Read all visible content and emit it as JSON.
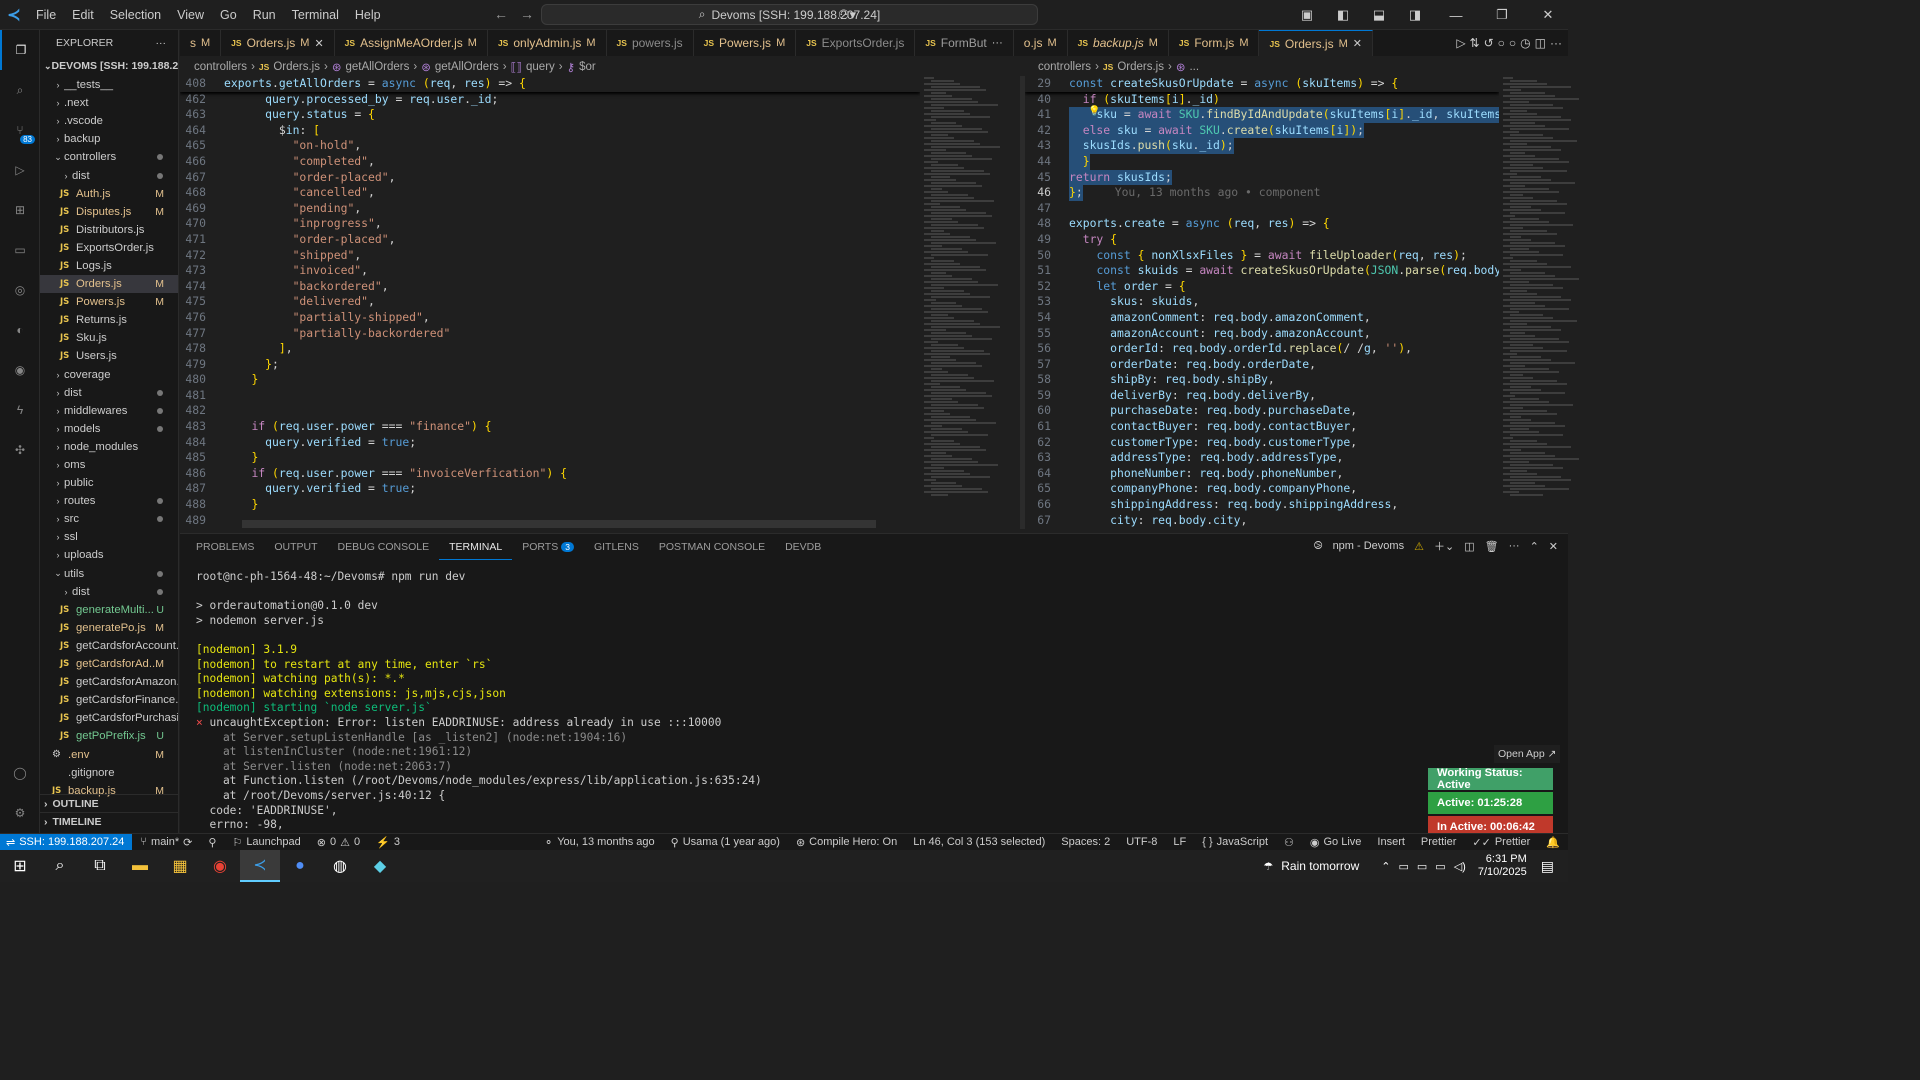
{
  "titlebar": {
    "menu": [
      "File",
      "Edit",
      "Selection",
      "View",
      "Go",
      "Run",
      "Terminal",
      "Help"
    ],
    "search": "Devoms [SSH: 199.188.207.24]"
  },
  "sidebar": {
    "title": "EXPLORER",
    "root": "DEVOMS [SSH: 199.188.20...",
    "items": [
      {
        "type": "folder",
        "label": "__tests__",
        "depth": 1,
        "open": false
      },
      {
        "type": "folder",
        "label": ".next",
        "depth": 1,
        "open": false
      },
      {
        "type": "folder",
        "label": ".vscode",
        "depth": 1,
        "open": false
      },
      {
        "type": "folder",
        "label": "backup",
        "depth": 1,
        "open": false
      },
      {
        "type": "folder",
        "label": "controllers",
        "depth": 1,
        "open": true,
        "dot": true
      },
      {
        "type": "folder",
        "label": "dist",
        "depth": 2,
        "open": false,
        "dot": true
      },
      {
        "type": "file",
        "label": "Auth.js",
        "depth": 2,
        "status": "M"
      },
      {
        "type": "file",
        "label": "Disputes.js",
        "depth": 2,
        "status": "M"
      },
      {
        "type": "file",
        "label": "Distributors.js",
        "depth": 2
      },
      {
        "type": "file",
        "label": "ExportsOrder.js",
        "depth": 2
      },
      {
        "type": "file",
        "label": "Logs.js",
        "depth": 2
      },
      {
        "type": "file",
        "label": "Orders.js",
        "depth": 2,
        "status": "M",
        "selected": true
      },
      {
        "type": "file",
        "label": "Powers.js",
        "depth": 2,
        "status": "M"
      },
      {
        "type": "file",
        "label": "Returns.js",
        "depth": 2
      },
      {
        "type": "file",
        "label": "Sku.js",
        "depth": 2
      },
      {
        "type": "file",
        "label": "Users.js",
        "depth": 2
      },
      {
        "type": "folder",
        "label": "coverage",
        "depth": 1,
        "open": false
      },
      {
        "type": "folder",
        "label": "dist",
        "depth": 1,
        "open": false,
        "dot": true
      },
      {
        "type": "folder",
        "label": "middlewares",
        "depth": 1,
        "open": false,
        "dot": true
      },
      {
        "type": "folder",
        "label": "models",
        "depth": 1,
        "open": false,
        "dot": true
      },
      {
        "type": "folder",
        "label": "node_modules",
        "depth": 1,
        "open": false
      },
      {
        "type": "folder",
        "label": "oms",
        "depth": 1,
        "open": false
      },
      {
        "type": "folder",
        "label": "public",
        "depth": 1,
        "open": false
      },
      {
        "type": "folder",
        "label": "routes",
        "depth": 1,
        "open": false,
        "dot": true
      },
      {
        "type": "folder",
        "label": "src",
        "depth": 1,
        "open": false,
        "dot": true
      },
      {
        "type": "folder",
        "label": "ssl",
        "depth": 1,
        "open": false
      },
      {
        "type": "folder",
        "label": "uploads",
        "depth": 1,
        "open": false
      },
      {
        "type": "folder",
        "label": "utils",
        "depth": 1,
        "open": true,
        "dot": true
      },
      {
        "type": "folder",
        "label": "dist",
        "depth": 2,
        "open": false,
        "dot": true
      },
      {
        "type": "file",
        "label": "generateMulti...",
        "depth": 2,
        "status": "U"
      },
      {
        "type": "file",
        "label": "generatePo.js",
        "depth": 2,
        "status": "M"
      },
      {
        "type": "file",
        "label": "getCardsforAccount.js",
        "depth": 2
      },
      {
        "type": "file",
        "label": "getCardsforAd...",
        "depth": 2,
        "status": "M"
      },
      {
        "type": "file",
        "label": "getCardsforAmazon.js",
        "depth": 2
      },
      {
        "type": "file",
        "label": "getCardsforFinance.js",
        "depth": 2
      },
      {
        "type": "file",
        "label": "getCardsforPurchasi...",
        "depth": 2
      },
      {
        "type": "file",
        "label": "getPoPrefix.js",
        "depth": 2,
        "status": "U"
      },
      {
        "type": "env",
        "label": ".env",
        "depth": 1,
        "status": "M"
      },
      {
        "type": "plain",
        "label": ".gitignore",
        "depth": 1
      },
      {
        "type": "file",
        "label": "backup.js",
        "depth": 1,
        "status": "M"
      }
    ],
    "outline": "OUTLINE",
    "timeline": "TIMELINE"
  },
  "tabs": [
    {
      "name": "s",
      "status": "M",
      "plain": true
    },
    {
      "name": "Orders.js",
      "status": "M",
      "close": true
    },
    {
      "name": "AssignMeAOrder.js",
      "status": "M"
    },
    {
      "name": "onlyAdmin.js",
      "status": "M"
    },
    {
      "name": "powers.js",
      "dim": true
    },
    {
      "name": "Powers.js",
      "status": "M"
    },
    {
      "name": "ExportsOrder.js",
      "dim": true
    },
    {
      "name": "FormBut",
      "more": true
    },
    {
      "name": "o.js",
      "status": "M",
      "plain": true
    },
    {
      "name": "backup.js",
      "status": "M",
      "italic": true
    },
    {
      "name": "Form.js",
      "status": "M"
    },
    {
      "name": "Orders.js",
      "status": "M",
      "close": true,
      "active": true
    }
  ],
  "left_crumbs": [
    "controllers",
    "Orders.js",
    "getAllOrders",
    "getAllOrders",
    "query",
    "$or"
  ],
  "right_crumbs": [
    "controllers",
    "Orders.js",
    "..."
  ],
  "left_sticky": {
    "num": "408",
    "html": "exports.getAllOrders = async (req, res) => {"
  },
  "left_lines": [
    {
      "n": "462",
      "t": "      query.processed_by = req.user._id;"
    },
    {
      "n": "463",
      "t": "      query.status = {"
    },
    {
      "n": "464",
      "t": "        $in: ["
    },
    {
      "n": "465",
      "t": "          \"on-hold\","
    },
    {
      "n": "466",
      "t": "          \"completed\","
    },
    {
      "n": "467",
      "t": "          \"order-placed\","
    },
    {
      "n": "468",
      "t": "          \"cancelled\","
    },
    {
      "n": "469",
      "t": "          \"pending\","
    },
    {
      "n": "470",
      "t": "          \"inprogress\","
    },
    {
      "n": "471",
      "t": "          \"order-placed\","
    },
    {
      "n": "472",
      "t": "          \"shipped\","
    },
    {
      "n": "473",
      "t": "          \"invoiced\","
    },
    {
      "n": "474",
      "t": "          \"backordered\","
    },
    {
      "n": "475",
      "t": "          \"delivered\","
    },
    {
      "n": "476",
      "t": "          \"partially-shipped\","
    },
    {
      "n": "477",
      "t": "          \"partially-backordered\""
    },
    {
      "n": "478",
      "t": "        ],"
    },
    {
      "n": "479",
      "t": "      };"
    },
    {
      "n": "480",
      "t": "    }"
    },
    {
      "n": "481",
      "t": ""
    },
    {
      "n": "482",
      "t": ""
    },
    {
      "n": "483",
      "t": "    if (req.user.power === \"finance\") {"
    },
    {
      "n": "484",
      "t": "      query.verified = true;"
    },
    {
      "n": "485",
      "t": "    }"
    },
    {
      "n": "486",
      "t": "    if (req.user.power === \"invoiceVerfication\") {"
    },
    {
      "n": "487",
      "t": "      query.verified = true;"
    },
    {
      "n": "488",
      "t": "    }"
    },
    {
      "n": "489",
      "t": ""
    }
  ],
  "right_sticky": {
    "num": "29",
    "text": "const createSkusOrUpdate = async (skuItems) => {"
  },
  "right_lines": [
    {
      "n": "40",
      "t": "  if (skuItems[i]._id)",
      "sel": false
    },
    {
      "n": "41",
      "t": "    sku = await SKU.findByIdAndUpdate(skuItems[i]._id, skuItems",
      "sel": true
    },
    {
      "n": "42",
      "t": "  else sku = await SKU.create(skuItems[i]);",
      "sel": true
    },
    {
      "n": "43",
      "t": "  skusIds.push(sku._id);",
      "sel": true
    },
    {
      "n": "44",
      "t": "  }",
      "sel": true
    },
    {
      "n": "45",
      "t": "return skusIds;",
      "sel": true
    },
    {
      "n": "46",
      "t": "};",
      "sel": true,
      "cur": true,
      "blame": "You, 13 months ago • component"
    },
    {
      "n": "47",
      "t": ""
    },
    {
      "n": "48",
      "t": "exports.create = async (req, res) => {"
    },
    {
      "n": "49",
      "t": "  try {"
    },
    {
      "n": "50",
      "t": "    const { nonXlsxFiles } = await fileUploader(req, res);"
    },
    {
      "n": "51",
      "t": "    const skuids = await createSkusOrUpdate(JSON.parse(req.body.s"
    },
    {
      "n": "52",
      "t": "    let order = {"
    },
    {
      "n": "53",
      "t": "      skus: skuids,"
    },
    {
      "n": "54",
      "t": "      amazonComment: req.body.amazonComment,"
    },
    {
      "n": "55",
      "t": "      amazonAccount: req.body.amazonAccount,"
    },
    {
      "n": "56",
      "t": "      orderId: req.body.orderId.replace(/ /g, ''),"
    },
    {
      "n": "57",
      "t": "      orderDate: req.body.orderDate,"
    },
    {
      "n": "58",
      "t": "      shipBy: req.body.shipBy,"
    },
    {
      "n": "59",
      "t": "      deliverBy: req.body.deliverBy,"
    },
    {
      "n": "60",
      "t": "      purchaseDate: req.body.purchaseDate,"
    },
    {
      "n": "61",
      "t": "      contactBuyer: req.body.contactBuyer,"
    },
    {
      "n": "62",
      "t": "      customerType: req.body.customerType,"
    },
    {
      "n": "63",
      "t": "      addressType: req.body.addressType,"
    },
    {
      "n": "64",
      "t": "      phoneNumber: req.body.phoneNumber,"
    },
    {
      "n": "65",
      "t": "      companyPhone: req.body.companyPhone,"
    },
    {
      "n": "66",
      "t": "      shippingAddress: req.body.shippingAddress,"
    },
    {
      "n": "67",
      "t": "      city: req.body.city,"
    }
  ],
  "panel": {
    "tabs": [
      "PROBLEMS",
      "OUTPUT",
      "DEBUG CONSOLE",
      "TERMINAL",
      "PORTS",
      "GITLENS",
      "POSTMAN CONSOLE",
      "DEVDB"
    ],
    "ports_badge": "3",
    "active_tab": "TERMINAL",
    "terminal_name": "npm - Devoms",
    "lines": [
      {
        "t": "root@nc-ph-1564-48:~/Devoms# npm run dev",
        "c": ""
      },
      {
        "t": "",
        "c": ""
      },
      {
        "t": "> orderautomation@0.1.0 dev",
        "c": ""
      },
      {
        "t": "> nodemon server.js",
        "c": ""
      },
      {
        "t": "",
        "c": ""
      },
      {
        "t": "[nodemon] 3.1.9",
        "c": "y"
      },
      {
        "t": "[nodemon] to restart at any time, enter `rs`",
        "c": "y"
      },
      {
        "t": "[nodemon] watching path(s): *.*",
        "c": "y"
      },
      {
        "t": "[nodemon] watching extensions: js,mjs,cjs,json",
        "c": "y"
      },
      {
        "t": "[nodemon] starting `node server.js`",
        "c": "g"
      },
      {
        "t": "uncaughtException: Error: listen EADDRINUSE: address already in use :::10000",
        "c": "err"
      },
      {
        "t": "    at Server.setupListenHandle [as _listen2] (node:net:1904:16)",
        "c": "gr"
      },
      {
        "t": "    at listenInCluster (node:net:1961:12)",
        "c": "gr"
      },
      {
        "t": "    at Server.listen (node:net:2063:7)",
        "c": "gr"
      },
      {
        "t": "    at Function.listen (/root/Devoms/node_modules/express/lib/application.js:635:24)",
        "c": ""
      },
      {
        "t": "    at /root/Devoms/server.js:40:12 {",
        "c": ""
      },
      {
        "t": "  code: 'EADDRINUSE',",
        "c": "code"
      },
      {
        "t": "  errno: -98,",
        "c": "errno"
      }
    ],
    "open_app": "Open App ↗"
  },
  "work_status": {
    "status": "Working Status: Active",
    "active": "Active: 01:25:28",
    "inactive": "In Active: 00:06:42",
    "colors": {
      "status": "#40a068",
      "active": "#2ea043",
      "inactive": "#c0392b"
    }
  },
  "statusbar": {
    "remote": "SSH: 199.188.207.24",
    "branch": "main*",
    "launchpad": "Launchpad",
    "errors": "0",
    "warnings": "0",
    "ports": "3",
    "blame": "You, 13 months ago",
    "author": "Usama (1 year ago)",
    "compile": "Compile Hero: On",
    "position": "Ln 46, Col 3 (153 selected)",
    "spaces": "Spaces: 2",
    "encoding": "UTF-8",
    "eol": "LF",
    "language": "JavaScript",
    "golive": "Go Live",
    "insert": "Insert",
    "prettier": "Prettier"
  },
  "taskbar": {
    "weather": "Rain tomorrow",
    "time": "6:31 PM",
    "date": "7/10/2025"
  }
}
